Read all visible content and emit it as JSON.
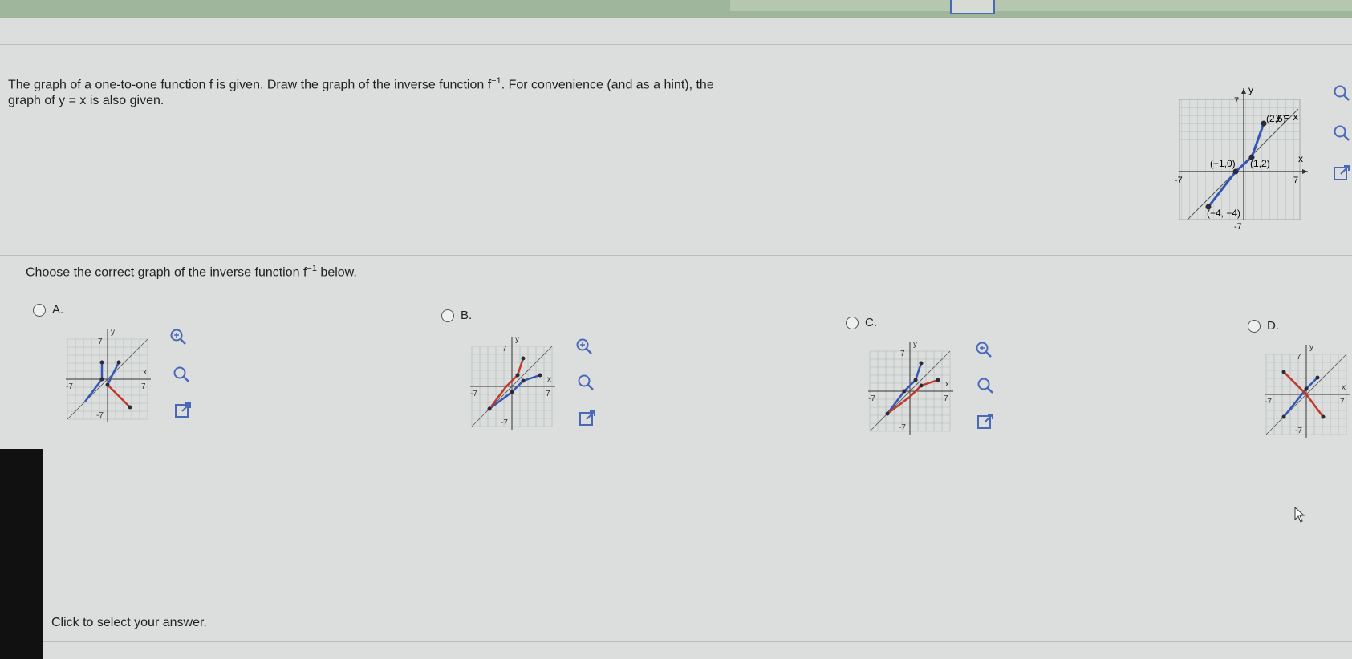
{
  "question": {
    "line1_pre": "The graph of a one-to-one function f is given. Draw the graph of the inverse function f",
    "sup": "−1",
    "line1_post": ". For convenience (and as a hint), the",
    "line2": "graph of y = x is also given."
  },
  "given_graph": {
    "y_label": "y",
    "x_label": "x",
    "tick_pos": "7",
    "tick_neg": "-7",
    "tick_neg_y": "-7",
    "line_label": "y = x",
    "point_labels": [
      "(2,5)",
      "(−1,0)",
      "(1,2)",
      "(−4, −4)"
    ]
  },
  "prompt": {
    "pre": "Choose the correct graph of the inverse function f",
    "sup": "−1",
    "post": " below."
  },
  "options": [
    {
      "label": "A."
    },
    {
      "label": "B."
    },
    {
      "label": "C."
    },
    {
      "label": "D."
    }
  ],
  "mini_axes": {
    "x": "x",
    "y": "y",
    "pos": "7",
    "neg": "-7"
  },
  "footer": "Click to select your answer.",
  "colors": {
    "blue": "#3556b5",
    "red": "#c0392b",
    "dark": "#2a2a3a",
    "grid": "#a9b6b3",
    "accent_zoom": "#4a68b8"
  }
}
